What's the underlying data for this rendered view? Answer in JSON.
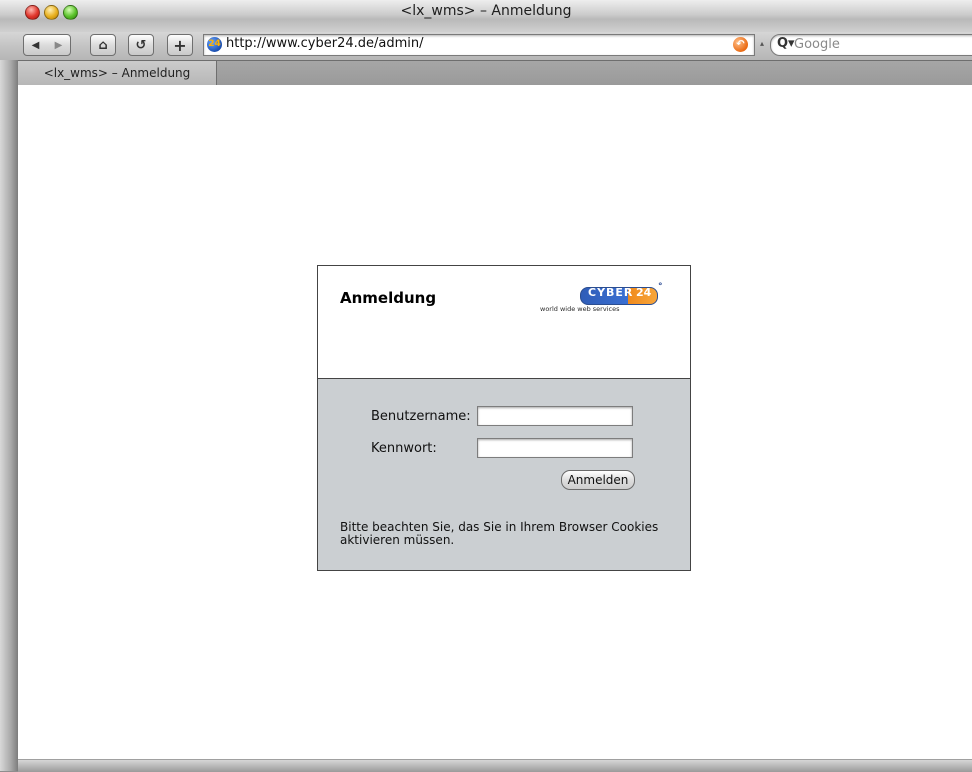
{
  "window": {
    "title": "<lx_wms> – Anmeldung"
  },
  "toolbar": {
    "back_icon": "◀",
    "forward_icon": "▶",
    "home_icon": "⌂",
    "reload_icon": "↺",
    "add_icon": "+",
    "url": "http://www.cyber24.de/admin/",
    "favicon_text": "24",
    "search_placeholder": "Google"
  },
  "tabs": [
    {
      "label": "<lx_wms> – Anmeldung"
    }
  ],
  "login": {
    "title": "Anmeldung",
    "logo": {
      "brand": "CYBER",
      "number": "24",
      "tagline": "world wide web services",
      "colors": {
        "blue": "#2f5db8",
        "orange": "#f08a1c"
      }
    },
    "username_label": "Benutzername:",
    "password_label": "Kennwort:",
    "username_value": "",
    "password_value": "",
    "submit_label": "Anmelden",
    "cookie_note": "Bitte beachten Sie, das Sie in Ihrem Browser Cookies aktivieren müssen."
  },
  "colors": {
    "form_background": "#cbcfd2",
    "page_background": "#ffffff"
  }
}
